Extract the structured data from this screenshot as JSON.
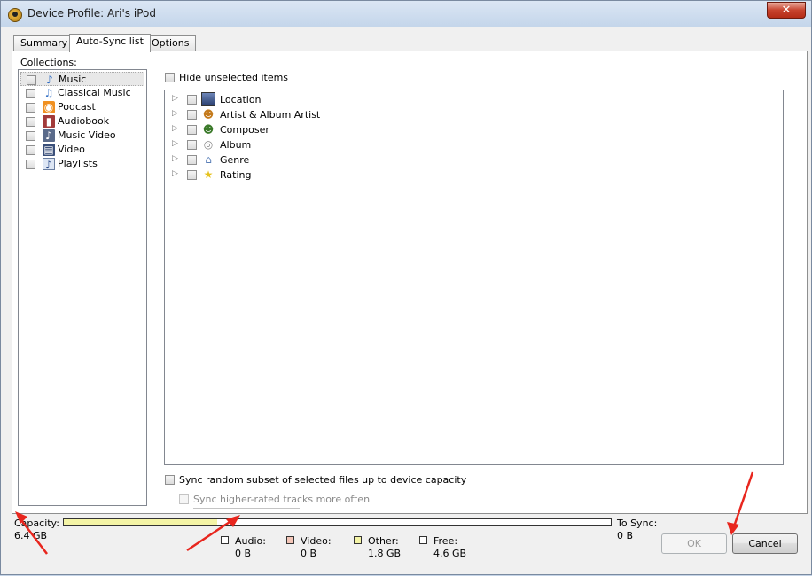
{
  "window": {
    "title": "Device Profile: Ari's iPod",
    "close_label": "✕"
  },
  "tabs": [
    {
      "label": "Summary"
    },
    {
      "label": "Auto-Sync list"
    },
    {
      "label": "Options"
    }
  ],
  "collections": {
    "label": "Collections:",
    "items": [
      {
        "label": "Music",
        "icon": "music-note-icon"
      },
      {
        "label": "Classical Music",
        "icon": "music-notes-icon"
      },
      {
        "label": "Podcast",
        "icon": "podcast-icon"
      },
      {
        "label": "Audiobook",
        "icon": "audiobook-icon"
      },
      {
        "label": "Music Video",
        "icon": "music-video-icon"
      },
      {
        "label": "Video",
        "icon": "video-icon"
      },
      {
        "label": "Playlists",
        "icon": "playlist-icon"
      }
    ]
  },
  "hide_unselected": "Hide unselected items",
  "tree": {
    "items": [
      {
        "label": "Location",
        "icon": "location-icon"
      },
      {
        "label": "Artist & Album Artist",
        "icon": "people-icon"
      },
      {
        "label": "Composer",
        "icon": "composer-icon"
      },
      {
        "label": "Album",
        "icon": "album-icon"
      },
      {
        "label": "Genre",
        "icon": "genre-icon"
      },
      {
        "label": "Rating",
        "icon": "star-icon"
      }
    ]
  },
  "sync_random": "Sync random subset of selected files up to device capacity",
  "sync_higher_rated": "Sync higher-rated tracks more often",
  "capacity": {
    "label": "Capacity:",
    "value": "6.4 GB",
    "to_sync_label": "To Sync:",
    "to_sync_value": "0 B",
    "other_fraction": 0.28,
    "legend": [
      {
        "name": "Audio:",
        "value": "0 B",
        "color": "#ffffff"
      },
      {
        "name": "Video:",
        "value": "0 B",
        "color": "#f4c6b8"
      },
      {
        "name": "Other:",
        "value": "1.8 GB",
        "color": "#f4f4a6"
      },
      {
        "name": "Free:",
        "value": "4.6 GB",
        "color": "#ffffff"
      }
    ]
  },
  "buttons": {
    "ok": "OK",
    "cancel": "Cancel"
  },
  "colors": {
    "annotation_arrow": "#e8261e"
  }
}
